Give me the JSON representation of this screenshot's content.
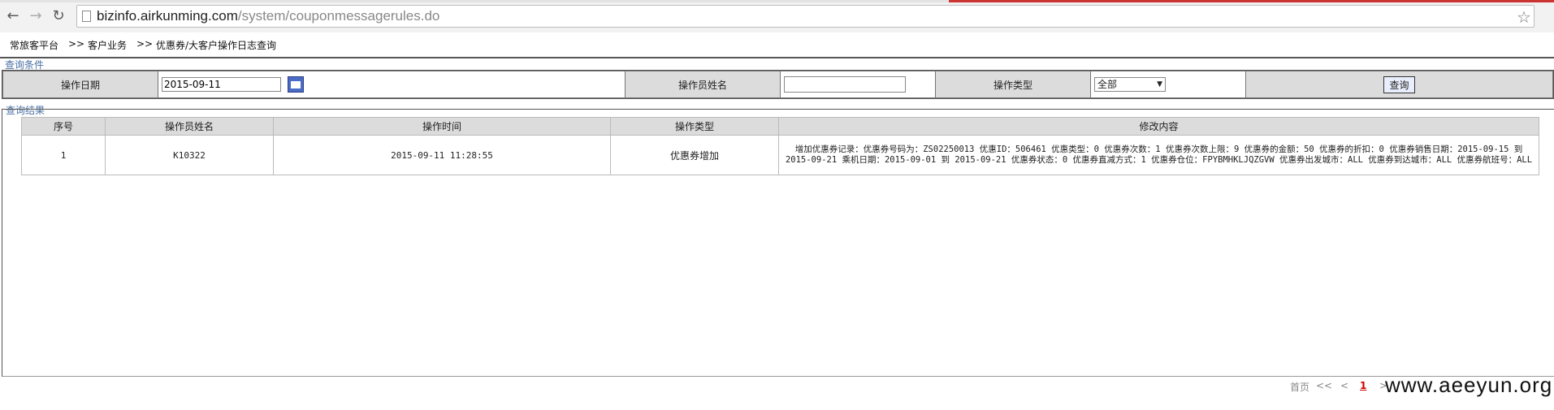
{
  "browser": {
    "url_host": "bizinfo.airkunming.com",
    "url_path": "/system/couponmessagerules.do"
  },
  "breadcrumb": {
    "items": [
      "常旅客平台",
      "客户业务",
      "优惠券/大客户操作日志查询"
    ],
    "separator": ">>"
  },
  "query": {
    "legend": "查询条件",
    "date_label": "操作日期",
    "date_value": "2015-09-11",
    "operator_label": "操作员姓名",
    "operator_value": "",
    "type_label": "操作类型",
    "type_selected": "全部",
    "search_button": "查询"
  },
  "results": {
    "legend": "查询结果",
    "columns": [
      "序号",
      "操作员姓名",
      "操作时间",
      "操作类型",
      "修改内容"
    ],
    "rows": [
      {
        "index": "1",
        "operator": "K10322",
        "time": "2015-09-11 11:28:55",
        "type": "优惠券增加",
        "content": "增加优惠券记录：优惠券号码为：ZS02250013 优惠ID：506461 优惠类型：0 优惠券次数：1 优惠券次数上限：9 优惠券的金额：50 优惠券的折扣：0 优惠券销售日期：2015-09-15 到 2015-09-21 乘机日期：2015-09-01 到 2015-09-21 优惠券状态：0 优惠券直减方式：1 优惠券仓位：FPYBMHKLJQZGVW 优惠券出发城市：ALL 优惠券到达城市：ALL 优惠券航班号：ALL"
      }
    ]
  },
  "pager": {
    "first": "首页",
    "prev_block": "<<",
    "prev": "<",
    "current_page": "1",
    "next": ">"
  },
  "watermark": "www.aeeyun.org"
}
